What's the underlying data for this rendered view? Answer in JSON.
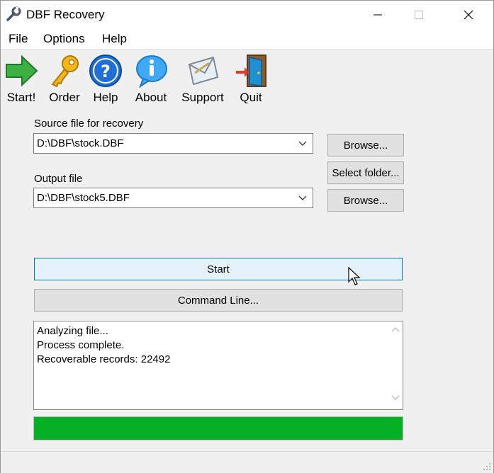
{
  "window": {
    "title": "DBF Recovery",
    "app_icon": "wrench-icon"
  },
  "menu": [
    "File",
    "Options",
    "Help"
  ],
  "toolbar": [
    {
      "label": "Start!",
      "icon": "green-arrow-icon"
    },
    {
      "label": "Order",
      "icon": "key-icon"
    },
    {
      "label": "Help",
      "icon": "question-icon"
    },
    {
      "label": "About",
      "icon": "info-icon"
    },
    {
      "label": "Support",
      "icon": "envelope-icon"
    },
    {
      "label": "Quit",
      "icon": "door-exit-icon"
    }
  ],
  "source": {
    "label": "Source file for recovery",
    "value": "D:\\DBF\\stock.DBF",
    "browse_label": "Browse..."
  },
  "output": {
    "label": "Output file",
    "value": "D:\\DBF\\stock5.DBF",
    "select_folder_label": "Select folder...",
    "browse_label": "Browse..."
  },
  "actions": {
    "start_label": "Start",
    "command_line_label": "Command Line..."
  },
  "log": [
    "Analyzing file...",
    "Process complete.",
    "Recoverable records: 22492"
  ],
  "progress_percent": 100,
  "colors": {
    "progress_fill": "#06b025",
    "focus_border": "#0078d7",
    "focus_bg": "#e5f1fb"
  }
}
